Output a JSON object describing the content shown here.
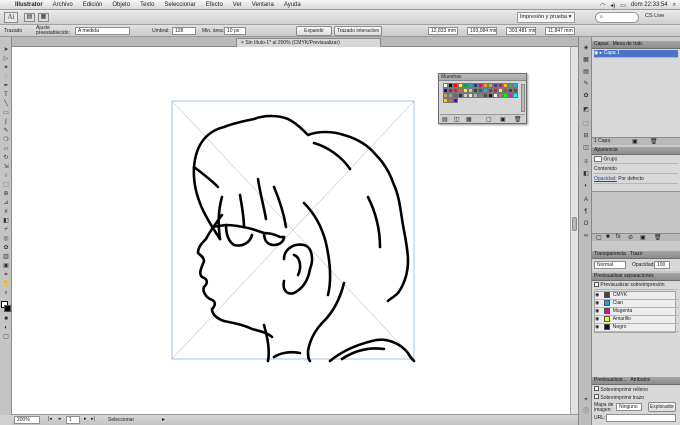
{
  "menubar": {
    "app_name": "Illustrator",
    "items": [
      "Archivo",
      "Edición",
      "Objeto",
      "Texto",
      "Seleccionar",
      "Efecto",
      "Ver",
      "Ventana",
      "Ayuda"
    ],
    "clock": "dom 22:33:54"
  },
  "appbar": {
    "logo_text": "Ai",
    "workspace": "Impresión y prueba ▾",
    "search_placeholder": "",
    "cs_live": "CS Live"
  },
  "control_bar": {
    "selection_label": "Trazado",
    "brush_label": "Ajuste preestablecido:",
    "brush_value": "A medida",
    "threshold_label": "Umbral:",
    "threshold_value": "128",
    "min_area_label": "Min. área:",
    "min_area_value": "10 px",
    "expand_button": "Expandir",
    "tracing_button": "Trazado interactivo",
    "x_value": "12,833 mm",
    "y_value": "193,084 mm",
    "w_value": "303,481 mm",
    "h_value": "11,847 mm"
  },
  "document": {
    "tab_title": "Sin título-1* al 200% (CMYK/Previsualizar)"
  },
  "status": {
    "zoom": "200%",
    "page": "1",
    "info": "Seleccionar"
  },
  "swatches_panel": {
    "title": "Muestras",
    "colors": [
      "#ffffff",
      "#000000",
      "#ff0000",
      "#ffff00",
      "#00a651",
      "#00aeef",
      "#2e3192",
      "#ec008c",
      "#f7941d",
      "#8dc63f",
      "#662d91",
      "#c1272d",
      "#fbb040",
      "#39b54a",
      "#27aae1",
      "#1b1464",
      "#9e1f63",
      "#ed1c24",
      "#f15a24",
      "#fcee21",
      "#d9e021",
      "#006837",
      "#0071bc",
      "#29abe2",
      "#93278f",
      "#d4145a",
      "#fff200",
      "#8c6239",
      "#603813",
      "#754c24",
      "#c69c6d",
      "#999999",
      "#666666",
      "#333333",
      "#cccccc",
      "#e6e6e6",
      "#b3b3b3",
      "#808080",
      "#4d4d4d",
      "#1a1a1a",
      "#f2f2f2",
      "#a67c52",
      "#00ff00",
      "#ff00ff",
      "#00ffff",
      "#ffcc00",
      "#ff6600",
      "#6600cc"
    ]
  },
  "layers_panel": {
    "tab": "Capas",
    "tab2": "Mesa de trab.",
    "layer_name": "Capa 1",
    "footer": "1 Capa"
  },
  "appearance_panel": {
    "tab": "Apariencia",
    "row1": "Grupo",
    "row2": "Contenido",
    "row3_label": "Opacidad:",
    "row3_value": "Por defecto"
  },
  "transparency_panel": {
    "tab": "Transparencia",
    "tab2": "Trazo",
    "mode": "Normal",
    "opacity_label": "Opacidad:",
    "opacity_value": "100"
  },
  "separations_panel": {
    "tab": "Previsualizar separaciones",
    "overprint": "Previsualizar sobreimpresión",
    "plates": [
      {
        "name": "CMYK",
        "color": "#444444"
      },
      {
        "name": "Cian",
        "color": "#00aeef"
      },
      {
        "name": "Magenta",
        "color": "#ec008c"
      },
      {
        "name": "Amarillo",
        "color": "#fff200"
      },
      {
        "name": "Negro",
        "color": "#111111"
      }
    ]
  },
  "attributes_panel": {
    "tab1": "Previsualizar...",
    "tab2": "Atributos",
    "overprint_fill": "Sobreimprimir relleno",
    "overprint_stroke": "Sobreimprimir trazo",
    "image_map_label": "Mapa de imagen:",
    "image_map_value": "Ninguno",
    "url_label": "URL:",
    "browser_button": "Explorador"
  }
}
